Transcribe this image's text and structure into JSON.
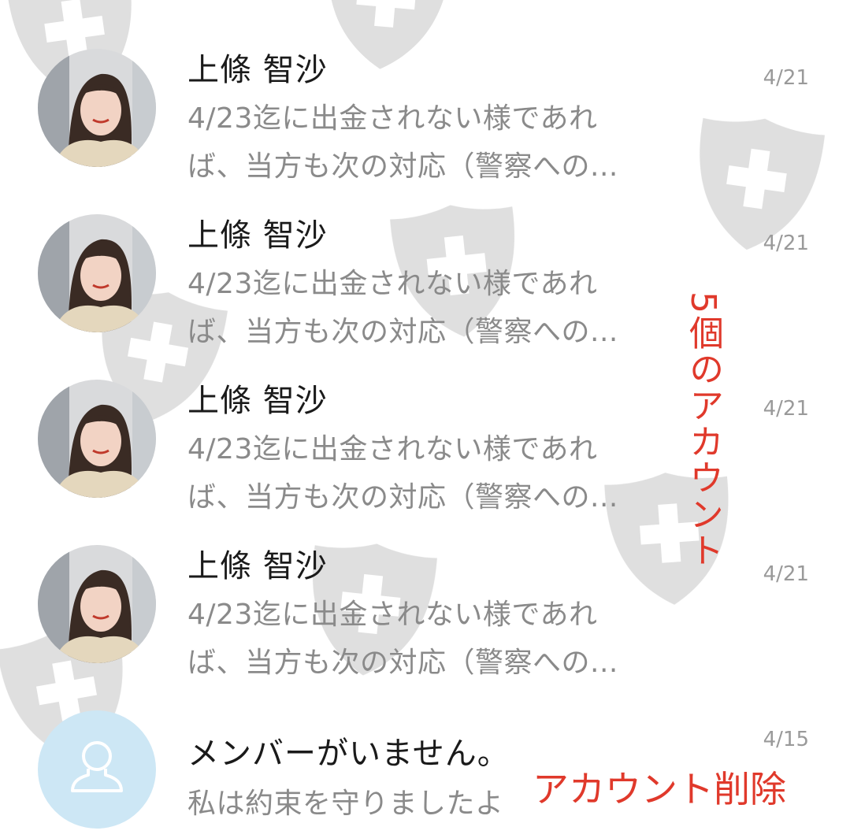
{
  "chats": [
    {
      "name": "上條  智沙",
      "preview_line1": "4/23迄に出金されない様であれ",
      "preview_line2": "ば、当方も次の対応（警察への...",
      "date": "4/21",
      "avatar": "profile-photo"
    },
    {
      "name": "上條  智沙",
      "preview_line1": "4/23迄に出金されない様であれ",
      "preview_line2": "ば、当方も次の対応（警察への...",
      "date": "4/21",
      "avatar": "profile-photo"
    },
    {
      "name": "上條  智沙",
      "preview_line1": "4/23迄に出金されない様であれ",
      "preview_line2": "ば、当方も次の対応（警察への...",
      "date": "4/21",
      "avatar": "profile-photo"
    },
    {
      "name": "上條  智沙",
      "preview_line1": "4/23迄に出金されない様であれ",
      "preview_line2": "ば、当方も次の対応（警察への...",
      "date": "4/21",
      "avatar": "profile-photo"
    },
    {
      "name": "メンバーがいません。",
      "preview_line1": "私は約束を守りましたよ",
      "date": "4/15",
      "avatar": "default-user-icon"
    }
  ],
  "annotations": {
    "vertical_label": "5個のアカウント",
    "delete_label": "アカウント削除",
    "color": "#e0392b"
  },
  "colors": {
    "name_text": "#1a1a1a",
    "preview_text": "#8a8a8a",
    "date_text": "#9a9a9a",
    "default_avatar_bg": "#cde7f5",
    "watermark": "#d8d8d8"
  }
}
